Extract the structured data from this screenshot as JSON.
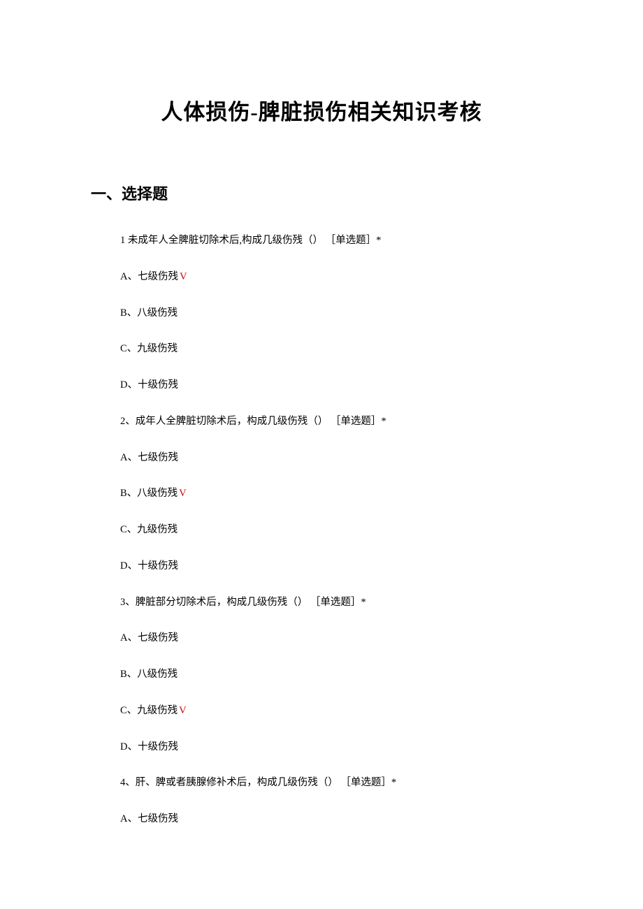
{
  "title": "人体损伤-脾脏损伤相关知识考核",
  "section_header": "一、选择题",
  "check_mark": "V",
  "questions": [
    {
      "number": "1",
      "separator": " ",
      "text": "未成年人全脾脏切除术后,构成几级伤残（） ［单选题］*",
      "options": [
        {
          "label": "A、七级伤残",
          "correct": true
        },
        {
          "label": "B、八级伤残",
          "correct": false
        },
        {
          "label": "C、九级伤残",
          "correct": false
        },
        {
          "label": "D、十级伤残",
          "correct": false
        }
      ]
    },
    {
      "number": "2",
      "separator": "、",
      "text": "成年人全脾脏切除术后，构成几级伤残（） ［单选题］*",
      "options": [
        {
          "label": "A、七级伤残",
          "correct": false
        },
        {
          "label": "B、八级伤残",
          "correct": true
        },
        {
          "label": "C、九级伤残",
          "correct": false
        },
        {
          "label": "D、十级伤残",
          "correct": false
        }
      ]
    },
    {
      "number": "3",
      "separator": "、",
      "text": "脾脏部分切除术后，构成几级伤残（） ［单选题］*",
      "options": [
        {
          "label": "A、七级伤残",
          "correct": false
        },
        {
          "label": "B、八级伤残",
          "correct": false
        },
        {
          "label": "C、九级伤残",
          "correct": true
        },
        {
          "label": "D、十级伤残",
          "correct": false
        }
      ]
    },
    {
      "number": "4",
      "separator": "、",
      "text": "肝、脾或者胰腺修补术后，构成几级伤残（） ［单选题］*",
      "options": [
        {
          "label": "A、七级伤残",
          "correct": false
        }
      ]
    }
  ]
}
